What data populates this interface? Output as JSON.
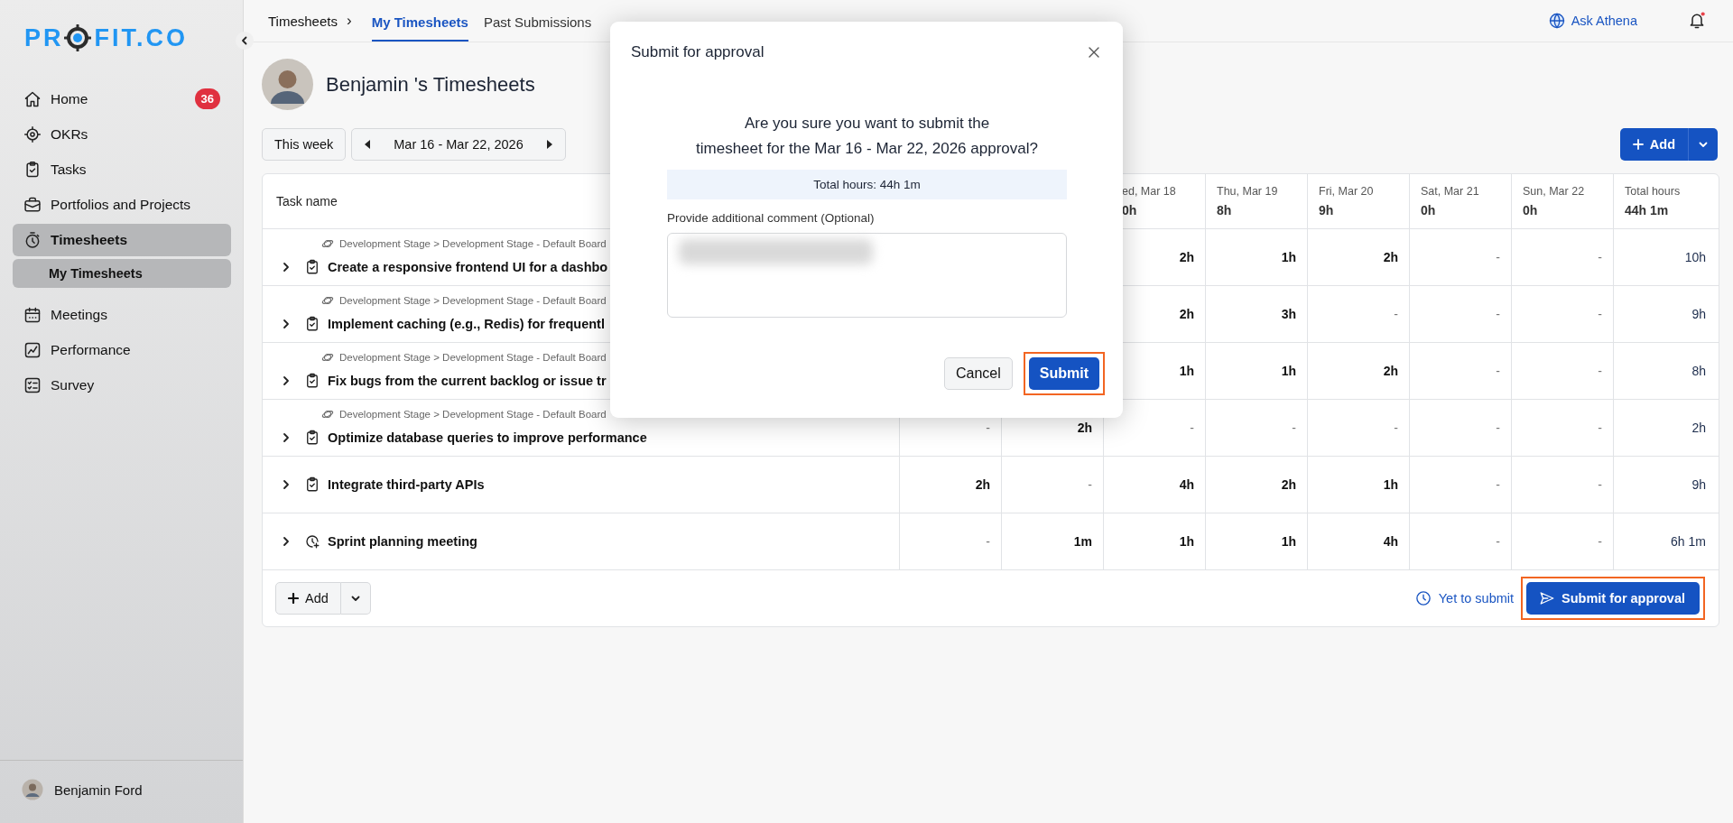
{
  "sidebar": {
    "logo": {
      "text_before": "PR",
      "text_after": "FIT.CO"
    },
    "items": [
      {
        "label": "Home",
        "badge": "36",
        "selected": false
      },
      {
        "label": "OKRs",
        "selected": false
      },
      {
        "label": "Tasks",
        "selected": false
      },
      {
        "label": "Portfolios and Projects",
        "selected": false
      },
      {
        "label": "Timesheets",
        "selected": true,
        "children": [
          {
            "label": "My Timesheets",
            "selected": true
          }
        ]
      },
      {
        "label": "Meetings",
        "selected": false
      },
      {
        "label": "Performance",
        "selected": false
      },
      {
        "label": "Survey",
        "selected": false
      }
    ],
    "user": {
      "name": "Benjamin Ford"
    }
  },
  "top_bar": {
    "breadcrumb": "Timesheets",
    "separator": "›",
    "tabs": [
      {
        "label": "My Timesheets",
        "selected": true
      },
      {
        "label": "Past Submissions",
        "selected": false
      }
    ],
    "assistant": "Ask Athena",
    "notifications": {
      "unread": true
    }
  },
  "page": {
    "title": "Benjamin 's Timesheets",
    "this_week": "This week",
    "date_range": "Mar 16 - Mar 22, 2026",
    "add_button": "Add"
  },
  "table": {
    "task_column": "Task name",
    "columns": [
      {
        "day": "ed, Mar 18",
        "hours": "0h"
      },
      {
        "day": "Thu, Mar 19",
        "hours": "8h"
      },
      {
        "day": "Fri, Mar 20",
        "hours": "9h"
      },
      {
        "day": "Sat, Mar 21",
        "hours": "0h"
      },
      {
        "day": "Sun, Mar 22",
        "hours": "0h"
      },
      {
        "day": "Total hours",
        "hours": "44h 1m"
      }
    ],
    "rows": [
      {
        "path": "Development Stage > Development Stage - Default Board",
        "name": "Create a responsive frontend UI for a dashbo",
        "kind": "task",
        "values": [
          "2h",
          "1h",
          "2h",
          "-",
          "-",
          "10h"
        ]
      },
      {
        "path": "Development Stage > Development Stage - Default Board",
        "name": "Implement caching (e.g., Redis) for frequentl",
        "kind": "task",
        "values": [
          "2h",
          "3h",
          "-",
          "-",
          "-",
          "9h"
        ]
      },
      {
        "path": "Development Stage > Development Stage - Default Board",
        "name": "Fix bugs from the current backlog or issue tr",
        "kind": "task",
        "values": [
          "1h",
          "1h",
          "2h",
          "-",
          "-",
          "8h"
        ]
      },
      {
        "path": "Development Stage > Development Stage - Default Board",
        "name": "Optimize database queries to improve performance",
        "kind": "task",
        "values": [
          "-",
          "2h",
          "-",
          "-",
          "-",
          "-",
          "-",
          "2h"
        ]
      },
      {
        "name": "Integrate third-party APIs",
        "kind": "task",
        "values": [
          "2h",
          "-",
          "4h",
          "2h",
          "1h",
          "-",
          "-",
          "9h"
        ]
      },
      {
        "name": "Sprint planning meeting",
        "kind": "meeting",
        "values": [
          "-",
          "1m",
          "1h",
          "1h",
          "4h",
          "-",
          "-",
          "6h 1m"
        ]
      }
    ]
  },
  "footer": {
    "add_button": "Add",
    "status": "Yet to submit",
    "submit": {
      "label": "Submit for approval",
      "highlighted": true
    }
  },
  "dialog": {
    "title": "Submit for approval",
    "question_lines": [
      "Are you sure you want to submit the",
      "timesheet for the Mar 16 - Mar 22, 2026 approval?"
    ],
    "total": "Total hours: 44h 1m",
    "comment_label": "Provide additional comment (Optional)",
    "buttons": [
      {
        "label": "Cancel",
        "kind": "secondary",
        "highlighted": false
      },
      {
        "label": "Submit",
        "kind": "primary",
        "highlighted": true
      }
    ]
  }
}
